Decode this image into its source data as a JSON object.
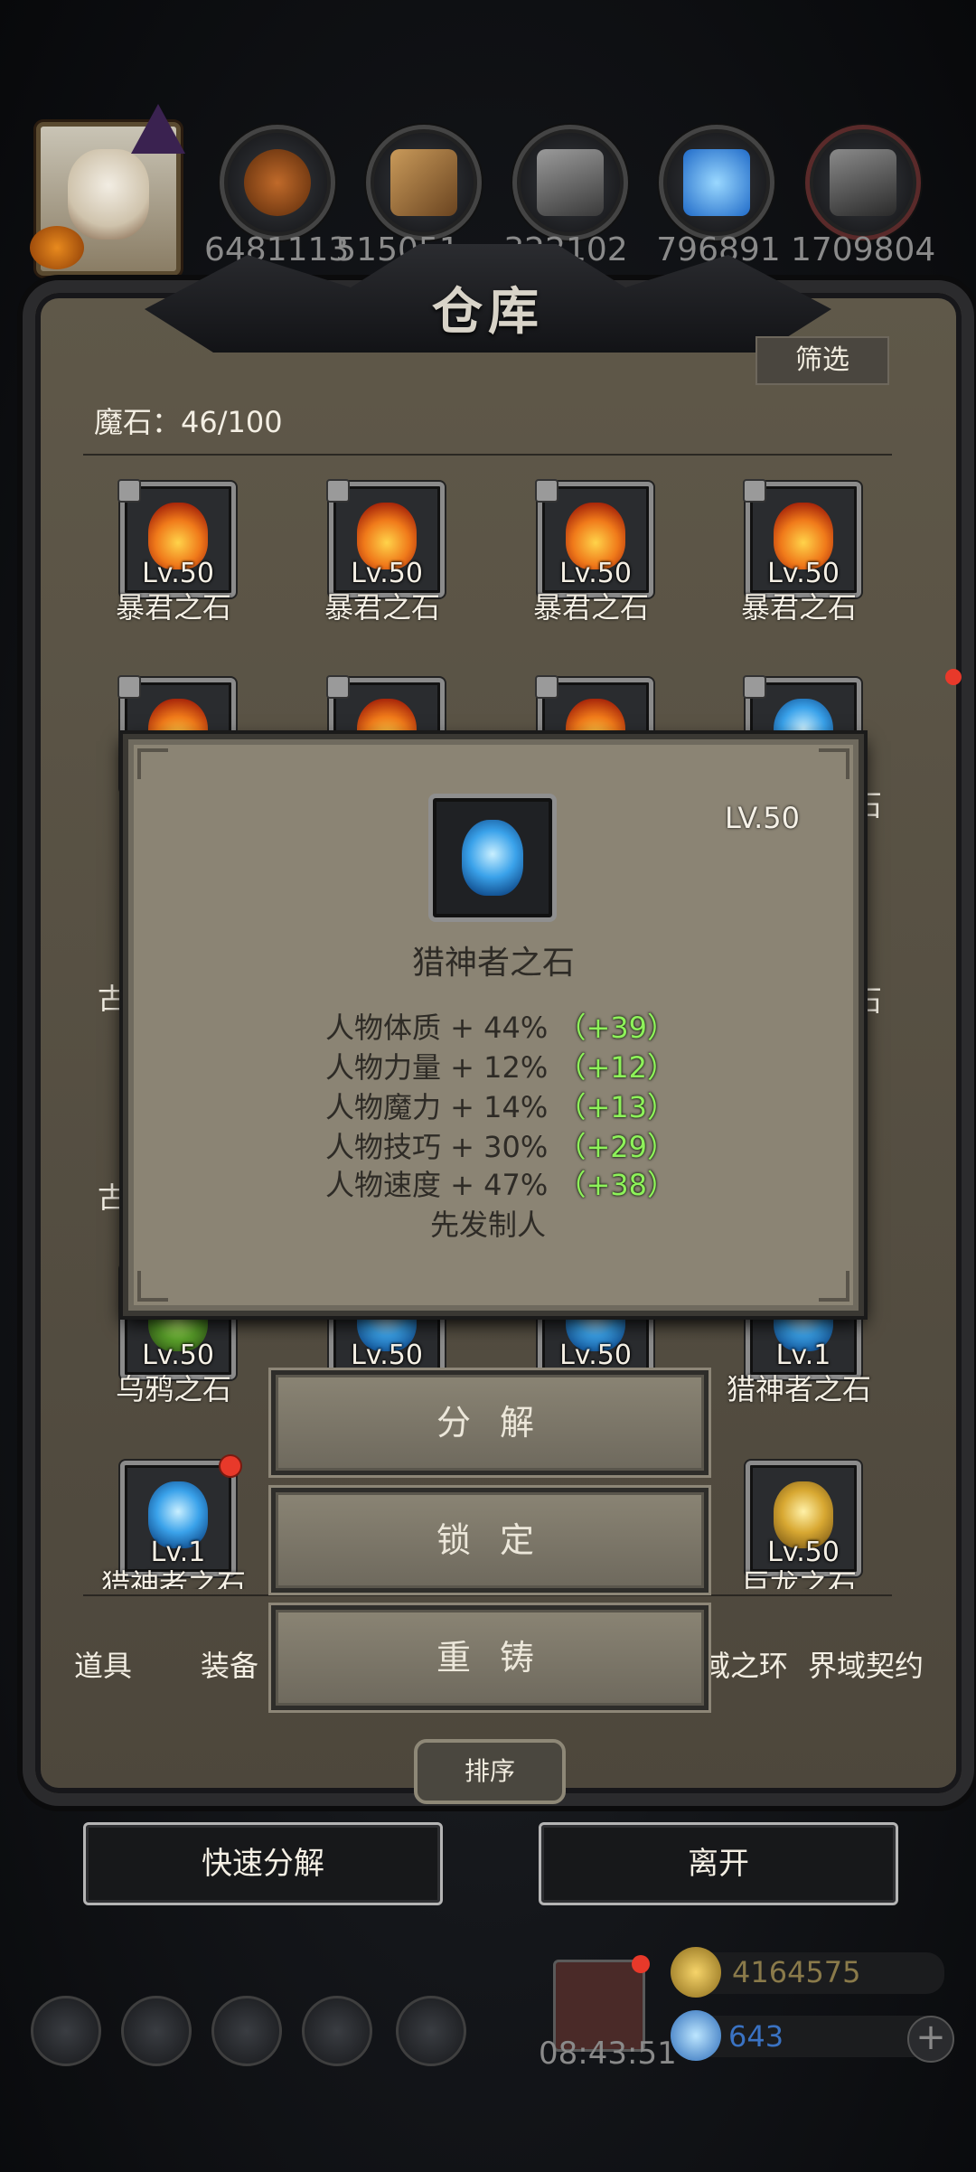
{
  "resources": [
    {
      "icon": "meat-icon",
      "value": "6481113",
      "color": "#8b4a1e"
    },
    {
      "icon": "wood-icon",
      "value": "515051",
      "color": "#a87a40"
    },
    {
      "icon": "stone-icon",
      "value": "322102",
      "color": "#6a6a6a"
    },
    {
      "icon": "crystal-icon",
      "value": "796891",
      "color": "#2f8be0"
    },
    {
      "icon": "iron-icon",
      "value": "1709804",
      "color": "#555555"
    }
  ],
  "warehouse": {
    "title": "仓库",
    "filter_label": "筛选",
    "magic_stone_count": "魔石：46/100"
  },
  "grid": {
    "row1": [
      {
        "name": "暴君之石",
        "level": "Lv.50",
        "locked": true
      },
      {
        "name": "暴君之石",
        "level": "Lv.50",
        "locked": true
      },
      {
        "name": "暴君之石",
        "level": "Lv.50",
        "locked": true
      },
      {
        "name": "暴君之石",
        "level": "Lv.50",
        "locked": true
      }
    ],
    "row4": [
      {
        "name": "乌鸦之石",
        "level": "Lv.50"
      },
      {
        "name": "",
        "level": "Lv.50"
      },
      {
        "name": "",
        "level": "Lv.50"
      },
      {
        "name": "猎神者之石",
        "level": "Lv.1"
      }
    ],
    "row5": [
      {
        "name": "猎神者之石",
        "level": "Lv.1",
        "new": true
      },
      {
        "name": "巨龙之石",
        "level": "Lv.50"
      }
    ],
    "partial_left": "古",
    "partial_right": "石"
  },
  "popup": {
    "level": "LV.50",
    "name": "猎神者之石",
    "stats": [
      {
        "label": "人物体质 + 44%",
        "bonus": "（+39）"
      },
      {
        "label": "人物力量 + 12%",
        "bonus": "（+12）"
      },
      {
        "label": "人物魔力 + 14%",
        "bonus": "（+13）"
      },
      {
        "label": "人物技巧 + 30%",
        "bonus": "（+29）"
      },
      {
        "label": "人物速度 + 47%",
        "bonus": "（+38）"
      }
    ],
    "creator": "先发制人"
  },
  "actions": {
    "decompose": "分 解",
    "lock": "锁 定",
    "reforge": "重 铸"
  },
  "tabs": {
    "items": "道具",
    "equipment": "装备",
    "realm_ring": "域之环",
    "realm_contract": "界域契约"
  },
  "sort_label": "排序",
  "quick_decompose": "快速分解",
  "leave": "离开",
  "hud": {
    "timer": "08:43:51",
    "gold": "4164575",
    "gems": "643",
    "plus": "+"
  }
}
